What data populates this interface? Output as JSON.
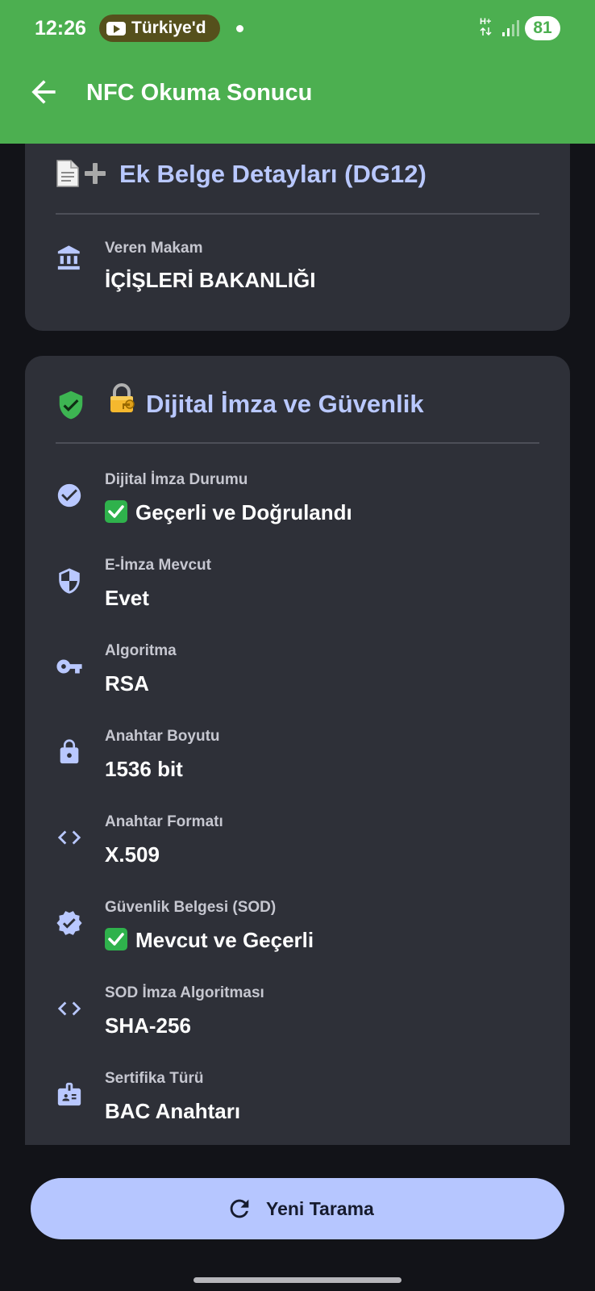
{
  "status_bar": {
    "time": "12:26",
    "notification_text": "Türkiye'd",
    "network_type": "H+",
    "battery": "81"
  },
  "header": {
    "title": "NFC Okuma Sonucu"
  },
  "card_additional_document": {
    "title": "Ek Belge Detayları (DG12)",
    "rows": [
      {
        "label": "Veren Makam",
        "value": "İÇİŞLERİ BAKANLIĞI",
        "icon": "bank-icon"
      }
    ]
  },
  "card_signature": {
    "title": "Dijital İmza ve Güvenlik",
    "rows": [
      {
        "label": "Dijital İmza Durumu",
        "value": "Geçerli ve Doğrulandı",
        "icon": "check-circle-icon"
      },
      {
        "label": "E-İmza Mevcut",
        "value": "Evet",
        "icon": "shield-icon"
      },
      {
        "label": "Algoritma",
        "value": "RSA",
        "icon": "key-icon"
      },
      {
        "label": "Anahtar Boyutu",
        "value": "1536 bit",
        "icon": "lock-icon"
      },
      {
        "label": "Anahtar Formatı",
        "value": "X.509",
        "icon": "code-icon"
      },
      {
        "label": "Güvenlik Belgesi (SOD)",
        "value": "Mevcut ve Geçerli",
        "icon": "verified-badge-icon"
      },
      {
        "label": "SOD İmza Algoritması",
        "value": "SHA-256",
        "icon": "code-icon"
      },
      {
        "label": "Sertifika Türü",
        "value": "BAC Anahtarı",
        "icon": "id-card-icon"
      }
    ]
  },
  "actions": {
    "new_scan_label": "Yeni Tarama"
  },
  "colors": {
    "app_bar": "#4caf50",
    "background": "#121318",
    "card": "#2e3038",
    "accent": "#b9c8ff",
    "button": "#b6c6ff"
  }
}
